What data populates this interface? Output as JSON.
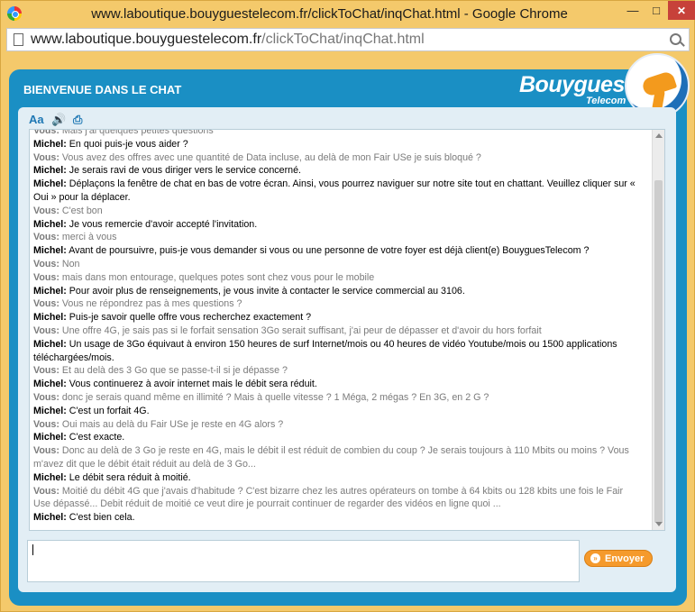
{
  "window": {
    "title": "www.laboutique.bouyguestelecom.fr/clickToChat/inqChat.html - Google Chrome",
    "minimize": "—",
    "maximize": "□",
    "close": "✕"
  },
  "address_bar": {
    "domain": "www.laboutique.bouyguestelecom.fr",
    "path": "/clickToChat/inqChat.html"
  },
  "header": {
    "title": "BIENVENUE DANS LE CHAT",
    "brand": "Bouygues",
    "brand_sub": "Telecom"
  },
  "toolbar": {
    "font_icon": "font-size-icon",
    "sound_icon": "speaker-icon",
    "print_icon": "print-icon",
    "font_glyph": "Aa",
    "sound_glyph": "🔊",
    "print_glyph": "⎙"
  },
  "messages": [
    {
      "speaker": "Vous:",
      "text": " Mais j'ai quelques petites questions",
      "type": "you"
    },
    {
      "speaker": "Michel:",
      "text": " En quoi puis-je vous aider ?",
      "type": "agent"
    },
    {
      "speaker": "Vous:",
      "text": " Vous avez des offres avec une quantité de Data incluse, au delà de mon Fair USe je suis bloqué ?",
      "type": "you"
    },
    {
      "speaker": "Michel:",
      "text": " Je serais ravi de vous diriger vers le service concerné.",
      "type": "agent"
    },
    {
      "speaker": "Michel:",
      "text": " Déplaçons la fenêtre de chat en bas de votre écran. Ainsi, vous pourrez naviguer sur notre site tout en chattant. Veuillez cliquer sur « Oui » pour la déplacer.",
      "type": "agent"
    },
    {
      "speaker": "Vous:",
      "text": " C'est bon",
      "type": "you"
    },
    {
      "speaker": "Michel:",
      "text": " Je vous remercie d'avoir accepté l'invitation.",
      "type": "agent"
    },
    {
      "speaker": "Vous:",
      "text": " merci à vous",
      "type": "you"
    },
    {
      "speaker": "Michel:",
      "text": " Avant de poursuivre, puis-je vous demander si vous ou une personne de votre foyer est déjà client(e) BouyguesTelecom ?",
      "type": "agent"
    },
    {
      "speaker": "Vous:",
      "text": " Non",
      "type": "you"
    },
    {
      "speaker": "Vous:",
      "text": " mais dans mon entourage, quelques potes sont chez vous pour le mobile",
      "type": "you"
    },
    {
      "speaker": "Michel:",
      "text": " Pour avoir plus de renseignements, je vous invite à contacter le service commercial au 3106.",
      "type": "agent"
    },
    {
      "speaker": "Vous:",
      "text": " Vous ne répondrez pas à mes questions ?",
      "type": "you"
    },
    {
      "speaker": "Michel:",
      "text": " Puis-je savoir quelle offre vous recherchez exactement ?",
      "type": "agent"
    },
    {
      "speaker": "Vous:",
      "text": " Une offre 4G, je sais pas si le forfait sensation 3Go serait suffisant, j'ai peur de dépasser et d'avoir du hors forfait",
      "type": "you"
    },
    {
      "speaker": "Michel:",
      "text": " Un usage de 3Go équivaut à environ 150 heures de surf Internet/mois ou 40 heures de vidéo Youtube/mois ou 1500 applications téléchargées/mois.",
      "type": "agent"
    },
    {
      "speaker": "Vous:",
      "text": " Et au delà des 3 Go que se passe-t-il si je dépasse ?",
      "type": "you"
    },
    {
      "speaker": "Michel:",
      "text": " Vous continuerez à avoir internet mais le débit sera réduit.",
      "type": "agent"
    },
    {
      "speaker": "Vous:",
      "text": " donc je serais quand même en illimité ? Mais à quelle vitesse ? 1 Méga, 2 mégas ? En 3G, en 2 G ?",
      "type": "you"
    },
    {
      "speaker": "Michel:",
      "text": " C'est un forfait 4G.",
      "type": "agent"
    },
    {
      "speaker": "Vous:",
      "text": " Oui mais au delà du Fair USe je reste en 4G alors ?",
      "type": "you"
    },
    {
      "speaker": "Michel:",
      "text": " C'est exacte.",
      "type": "agent"
    },
    {
      "speaker": "Vous:",
      "text": " Donc au delà de 3 Go je reste en 4G, mais le débit il est réduit de combien du coup ? Je serais toujours à 110 Mbits ou moins ? Vous m'avez dit que le débit était réduit au delà de 3 Go...",
      "type": "you"
    },
    {
      "speaker": "Michel:",
      "text": " Le débit sera réduit à moitié.",
      "type": "agent"
    },
    {
      "speaker": "Vous:",
      "text": " Moitié du débit 4G que j'avais d'habitude ? C'est bizarre chez les autres opérateurs on tombe à 64 kbits ou 128 kbits une fois le Fair Use dépassé... Debit réduit de moitié ce veut dire je pourrait continuer de regarder des vidéos en ligne quoi ...",
      "type": "you"
    },
    {
      "speaker": "Michel:",
      "text": " C'est bien cela.",
      "type": "agent"
    }
  ],
  "compose": {
    "value": "",
    "send_label": "Envoyer"
  }
}
